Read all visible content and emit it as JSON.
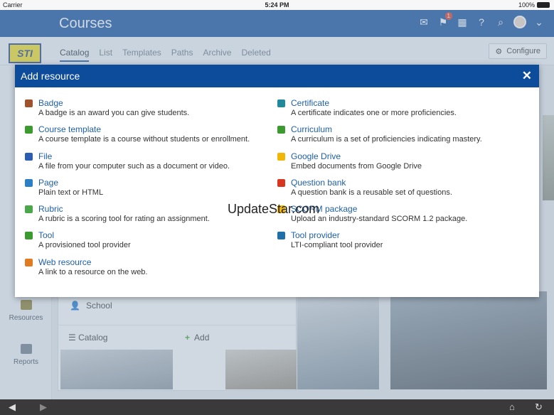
{
  "status": {
    "carrier": "Carrier",
    "time": "5:24 PM",
    "battery": "100%"
  },
  "header": {
    "title": "Courses",
    "notification_count": "1"
  },
  "subnav": {
    "logo": "STI",
    "tabs": [
      "Catalog",
      "List",
      "Templates",
      "Paths",
      "Archive",
      "Deleted"
    ],
    "configure_label": "Configure"
  },
  "sidebar": {
    "resources_label": "Resources",
    "reports_label": "Reports"
  },
  "content": {
    "school_label": "School",
    "catalog_label": "Catalog",
    "add_label": "Add"
  },
  "modal": {
    "title": "Add resource",
    "left": [
      {
        "name": "Badge",
        "desc": "A badge is an award you can give students.",
        "icon": "badge-icon",
        "color": "#a0522d"
      },
      {
        "name": "Course template",
        "desc": "A course template is a course without students or enrollment.",
        "icon": "puzzle-icon",
        "color": "#3b9b2e"
      },
      {
        "name": "File",
        "desc": "A file from your computer such as a document or video.",
        "icon": "word-file-icon",
        "color": "#2b5eb3"
      },
      {
        "name": "Page",
        "desc": "Plain text or HTML",
        "icon": "page-icon",
        "color": "#2b7fc7"
      },
      {
        "name": "Rubric",
        "desc": "A rubric is a scoring tool for rating an assignment.",
        "icon": "rubric-icon",
        "color": "#4aa84a"
      },
      {
        "name": "Tool",
        "desc": "A provisioned tool provider",
        "icon": "wrench-icon",
        "color": "#3b9b2e"
      },
      {
        "name": "Web resource",
        "desc": "A link to a resource on the web.",
        "icon": "globe-icon",
        "color": "#e07b1f"
      }
    ],
    "right": [
      {
        "name": "Certificate",
        "desc": "A certificate indicates one or more proficiencies.",
        "icon": "certificate-icon",
        "color": "#1f8a9b"
      },
      {
        "name": "Curriculum",
        "desc": "A curriculum is a set of proficiencies indicating mastery.",
        "icon": "bar-chart-icon",
        "color": "#3b9b2e"
      },
      {
        "name": "Google Drive",
        "desc": "Embed documents from Google Drive",
        "icon": "google-drive-icon",
        "color": "#f2b705"
      },
      {
        "name": "Question bank",
        "desc": "A question bank is a reusable set of questions.",
        "icon": "list-icon",
        "color": "#d9361f"
      },
      {
        "name": "SCORM package",
        "desc": "Upload an industry-standard SCORM 1.2 package.",
        "icon": "scorm-icon",
        "color": "#f2b705"
      },
      {
        "name": "Tool provider",
        "desc": "LTI-compliant tool provider",
        "icon": "tool-provider-icon",
        "color": "#1f6fa8"
      }
    ]
  },
  "watermark": "UpdateStar.com"
}
